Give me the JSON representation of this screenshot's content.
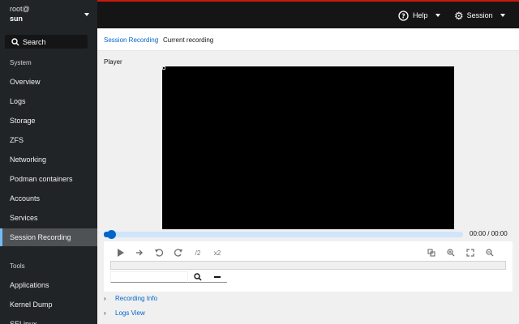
{
  "host": {
    "user": "root@",
    "name": "sun"
  },
  "sidebar": {
    "search_label": "Search",
    "system_label": "System",
    "items": [
      "Overview",
      "Logs",
      "Storage",
      "ZFS",
      "Networking",
      "Podman containers",
      "Accounts",
      "Services",
      "Session Recording"
    ],
    "active": "Session Recording",
    "tools_label": "Tools",
    "tools": [
      "Applications",
      "Kernel Dump",
      "SELinux"
    ]
  },
  "topbar": {
    "help_label": "Help",
    "session_label": "Session"
  },
  "breadcrumb": {
    "link": "Session Recording",
    "separator": "›",
    "current": "Current recording"
  },
  "player": {
    "title": "Player",
    "time": "00:00 / 00:00",
    "progress": 0,
    "speed_down_label": "/2",
    "speed_up_label": "x2"
  },
  "expanders": [
    "Recording Info",
    "Logs View"
  ],
  "colors": {
    "accent": "#0066cc",
    "sidebar": "#212427",
    "topbar": "#151515",
    "brand_line": "#c9190b"
  }
}
